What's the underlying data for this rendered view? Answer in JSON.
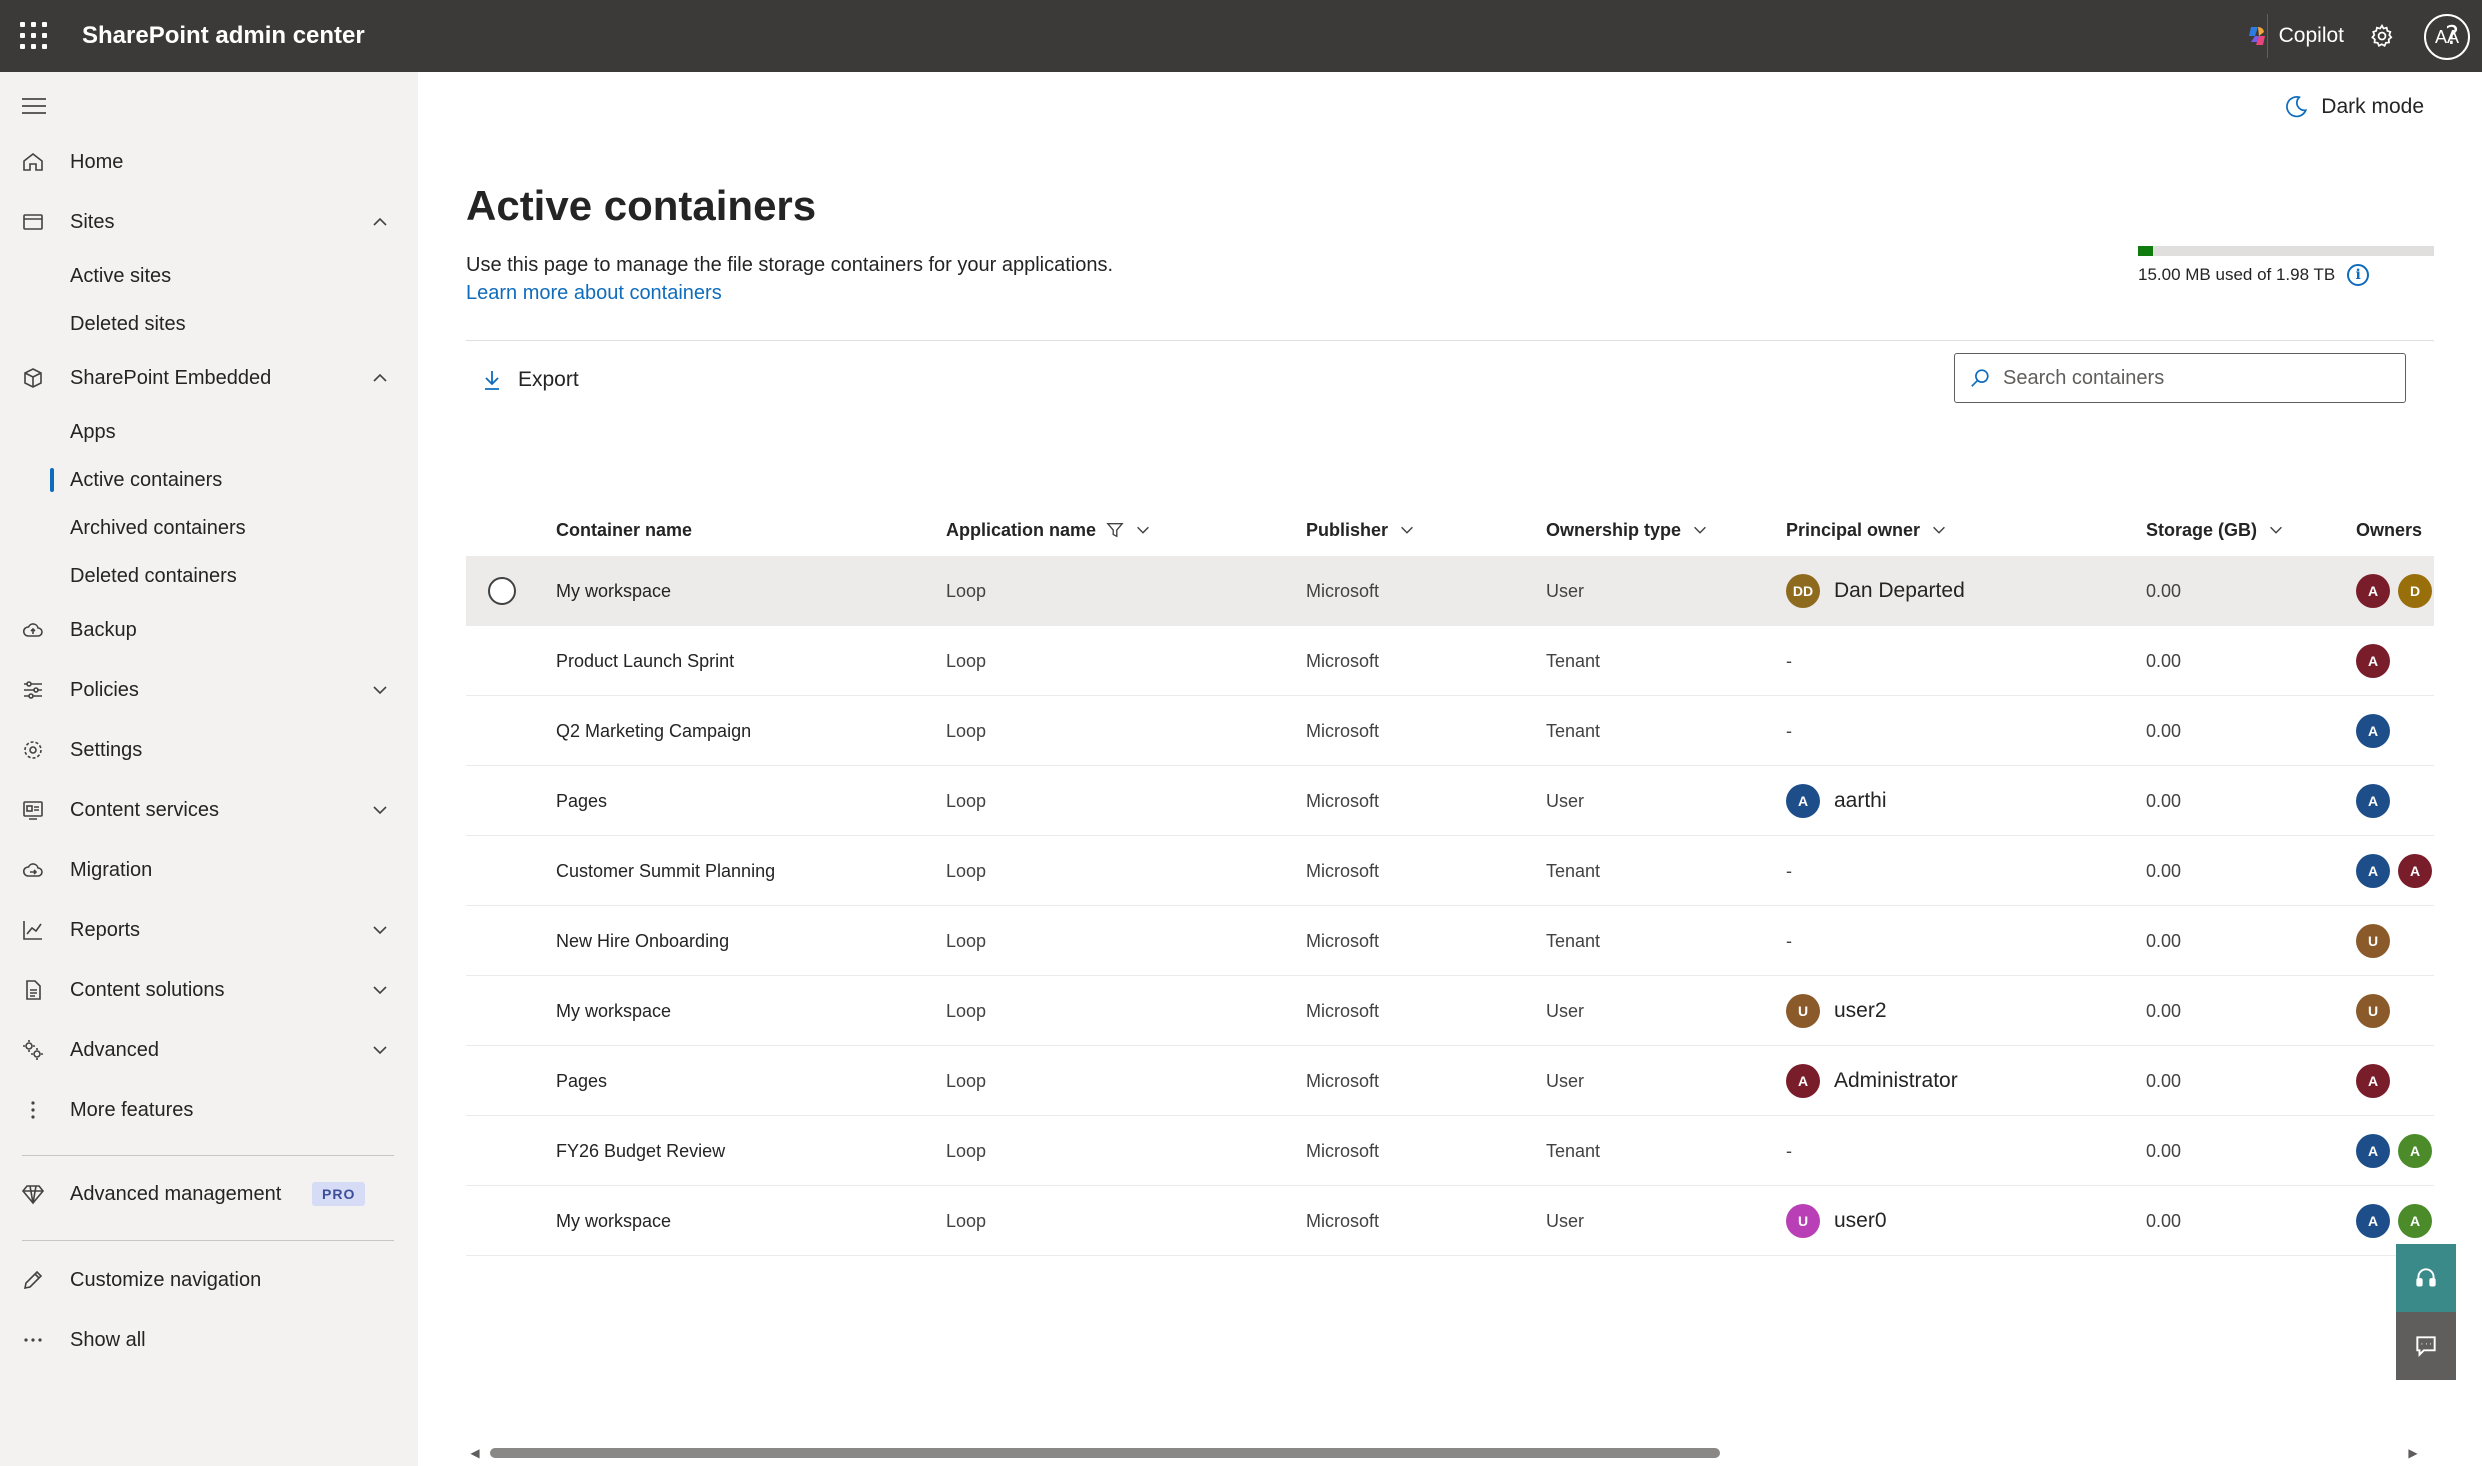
{
  "app": {
    "title": "SharePoint admin center"
  },
  "topbar": {
    "copilot_label": "Copilot",
    "avatar_initials": "AA"
  },
  "sidebar": {
    "home": "Home",
    "sites": "Sites",
    "active_sites": "Active sites",
    "deleted_sites": "Deleted sites",
    "sharepoint_embedded": "SharePoint Embedded",
    "apps": "Apps",
    "active_containers": "Active containers",
    "archived_containers": "Archived containers",
    "deleted_containers": "Deleted containers",
    "backup": "Backup",
    "policies": "Policies",
    "settings": "Settings",
    "content_services": "Content services",
    "migration": "Migration",
    "reports": "Reports",
    "content_solutions": "Content solutions",
    "advanced": "Advanced",
    "more_features": "More features",
    "advanced_management": "Advanced management",
    "pro_badge": "PRO",
    "customize_navigation": "Customize navigation",
    "show_all": "Show all"
  },
  "main": {
    "dark_mode": "Dark mode",
    "title": "Active containers",
    "description": "Use this page to manage the file storage containers for your applications.",
    "learn_more": "Learn more about containers",
    "storage": {
      "text": "15.00 MB used of 1.98 TB",
      "fraction": 0.05
    },
    "export_label": "Export",
    "search_placeholder": "Search containers"
  },
  "table": {
    "columns": {
      "container_name": "Container name",
      "application_name": "Application name",
      "publisher": "Publisher",
      "ownership_type": "Ownership type",
      "principal_owner": "Principal owner",
      "storage": "Storage (GB)",
      "owners": "Owners"
    },
    "rows": [
      {
        "name": "My workspace",
        "app": "Loop",
        "publisher": "Microsoft",
        "ownership": "User",
        "po_initials": "DD",
        "po_name": "Dan Departed",
        "po_color": "#8e6a1f",
        "storage": "0.00",
        "owners": [
          {
            "i": "A",
            "c": "#7a1d2a"
          },
          {
            "i": "D",
            "c": "#986f0b"
          }
        ]
      },
      {
        "name": "Product Launch Sprint",
        "app": "Loop",
        "publisher": "Microsoft",
        "ownership": "Tenant",
        "po_name": "-",
        "storage": "0.00",
        "owners": [
          {
            "i": "A",
            "c": "#7a1d2a"
          }
        ]
      },
      {
        "name": "Q2 Marketing Campaign",
        "app": "Loop",
        "publisher": "Microsoft",
        "ownership": "Tenant",
        "po_name": "-",
        "storage": "0.00",
        "owners": [
          {
            "i": "A",
            "c": "#1d4e89"
          }
        ]
      },
      {
        "name": "Pages",
        "app": "Loop",
        "publisher": "Microsoft",
        "ownership": "User",
        "po_initials": "A",
        "po_name": "aarthi",
        "po_color": "#1d4e89",
        "storage": "0.00",
        "owners": [
          {
            "i": "A",
            "c": "#1d4e89"
          }
        ]
      },
      {
        "name": "Customer Summit Planning",
        "app": "Loop",
        "publisher": "Microsoft",
        "ownership": "Tenant",
        "po_name": "-",
        "storage": "0.00",
        "owners": [
          {
            "i": "A",
            "c": "#1d4e89"
          },
          {
            "i": "A",
            "c": "#7a1d2a"
          }
        ]
      },
      {
        "name": "New Hire Onboarding",
        "app": "Loop",
        "publisher": "Microsoft",
        "ownership": "Tenant",
        "po_name": "-",
        "storage": "0.00",
        "owners": [
          {
            "i": "U",
            "c": "#8a5a2b"
          }
        ]
      },
      {
        "name": "My workspace",
        "app": "Loop",
        "publisher": "Microsoft",
        "ownership": "User",
        "po_initials": "U",
        "po_name": "user2",
        "po_color": "#8a5a2b",
        "storage": "0.00",
        "owners": [
          {
            "i": "U",
            "c": "#8a5a2b"
          }
        ]
      },
      {
        "name": "Pages",
        "app": "Loop",
        "publisher": "Microsoft",
        "ownership": "User",
        "po_initials": "A",
        "po_name": "Administrator",
        "po_color": "#7a1d2a",
        "storage": "0.00",
        "owners": [
          {
            "i": "A",
            "c": "#7a1d2a"
          }
        ]
      },
      {
        "name": "FY26 Budget Review",
        "app": "Loop",
        "publisher": "Microsoft",
        "ownership": "Tenant",
        "po_name": "-",
        "storage": "0.00",
        "owners": [
          {
            "i": "A",
            "c": "#1d4e89"
          },
          {
            "i": "A",
            "c": "#4b8b2a"
          }
        ]
      },
      {
        "name": "My workspace",
        "app": "Loop",
        "publisher": "Microsoft",
        "ownership": "User",
        "po_initials": "U",
        "po_name": "user0",
        "po_color": "#b83fb5",
        "storage": "0.00",
        "owners": [
          {
            "i": "A",
            "c": "#1d4e89"
          },
          {
            "i": "A",
            "c": "#4b8b2a"
          }
        ]
      }
    ]
  },
  "colors": {
    "topbar": "#3b3a39",
    "sidebar": "#f3f2f1",
    "accent": "#0f6cbd",
    "storage_fill": "#107c10",
    "help_button": "#3b8a8a",
    "feedback_button": "#605e5c"
  },
  "icons": [
    "waffle-icon",
    "copilot-icon",
    "gear-icon",
    "help-icon",
    "hamburger-icon",
    "home-icon",
    "sites-icon",
    "cube-icon",
    "cloud-icon",
    "sliders-icon",
    "gear-icon",
    "content-services-icon",
    "migration-icon",
    "chart-icon",
    "document-icon",
    "advanced-icon",
    "more-icon",
    "diamond-icon",
    "pencil-icon",
    "ellipsis-icon",
    "moon-icon",
    "info-icon",
    "download-icon",
    "search-icon",
    "filter-icon",
    "chevron-down-icon",
    "headset-icon",
    "feedback-icon"
  ]
}
